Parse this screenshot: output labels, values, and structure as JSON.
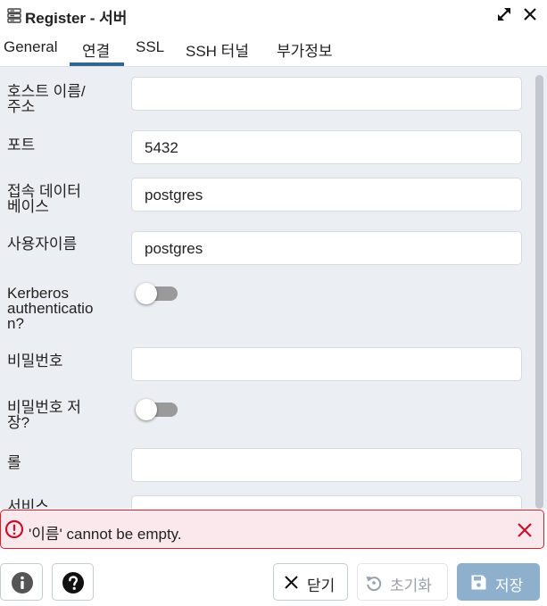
{
  "window": {
    "title": "Register - 서버"
  },
  "tabs": [
    {
      "label": "General"
    },
    {
      "label": "연결"
    },
    {
      "label": "SSL"
    },
    {
      "label": "SSH 터널"
    },
    {
      "label": "부가정보"
    }
  ],
  "active_tab": "연결",
  "form": {
    "host_label_line1": "호스트 이름/",
    "host_label_line2": "주소",
    "host_value": "",
    "port_label": "포트",
    "port_value": "5432",
    "maintenance_db_label_line1": "접속 데이터",
    "maintenance_db_label_line2": "베이스",
    "maintenance_db_value": "postgres",
    "username_label": "사용자이름",
    "username_value": "postgres",
    "kerberos_label_line1": "Kerberos",
    "kerberos_label_line2": "authenticatio",
    "kerberos_label_line3": "n?",
    "kerberos_enabled": false,
    "password_label": "비밀번호",
    "password_value": "",
    "save_password_label_line1": "비밀번호 저",
    "save_password_label_line2": "장?",
    "save_password_enabled": false,
    "role_label": "롤",
    "role_value": "",
    "service_label": "서비스",
    "service_value": ""
  },
  "error": {
    "message": "'이름' cannot be empty."
  },
  "footer": {
    "close_label": "닫기",
    "reset_label": "초기화",
    "save_label": "저장"
  },
  "colors": {
    "accent": "#326690",
    "error_border": "#d51f32",
    "error_bg": "#fbe8ec",
    "save_button_bg": "#8fb0cd",
    "form_bg": "#ebeef3"
  },
  "icons": {
    "title": "server-icon",
    "expand": "expand-icon",
    "close": "close-icon",
    "error": "alert-circle-icon",
    "info": "info-icon",
    "help": "help-icon",
    "reset": "reset-icon",
    "save": "save-icon"
  }
}
